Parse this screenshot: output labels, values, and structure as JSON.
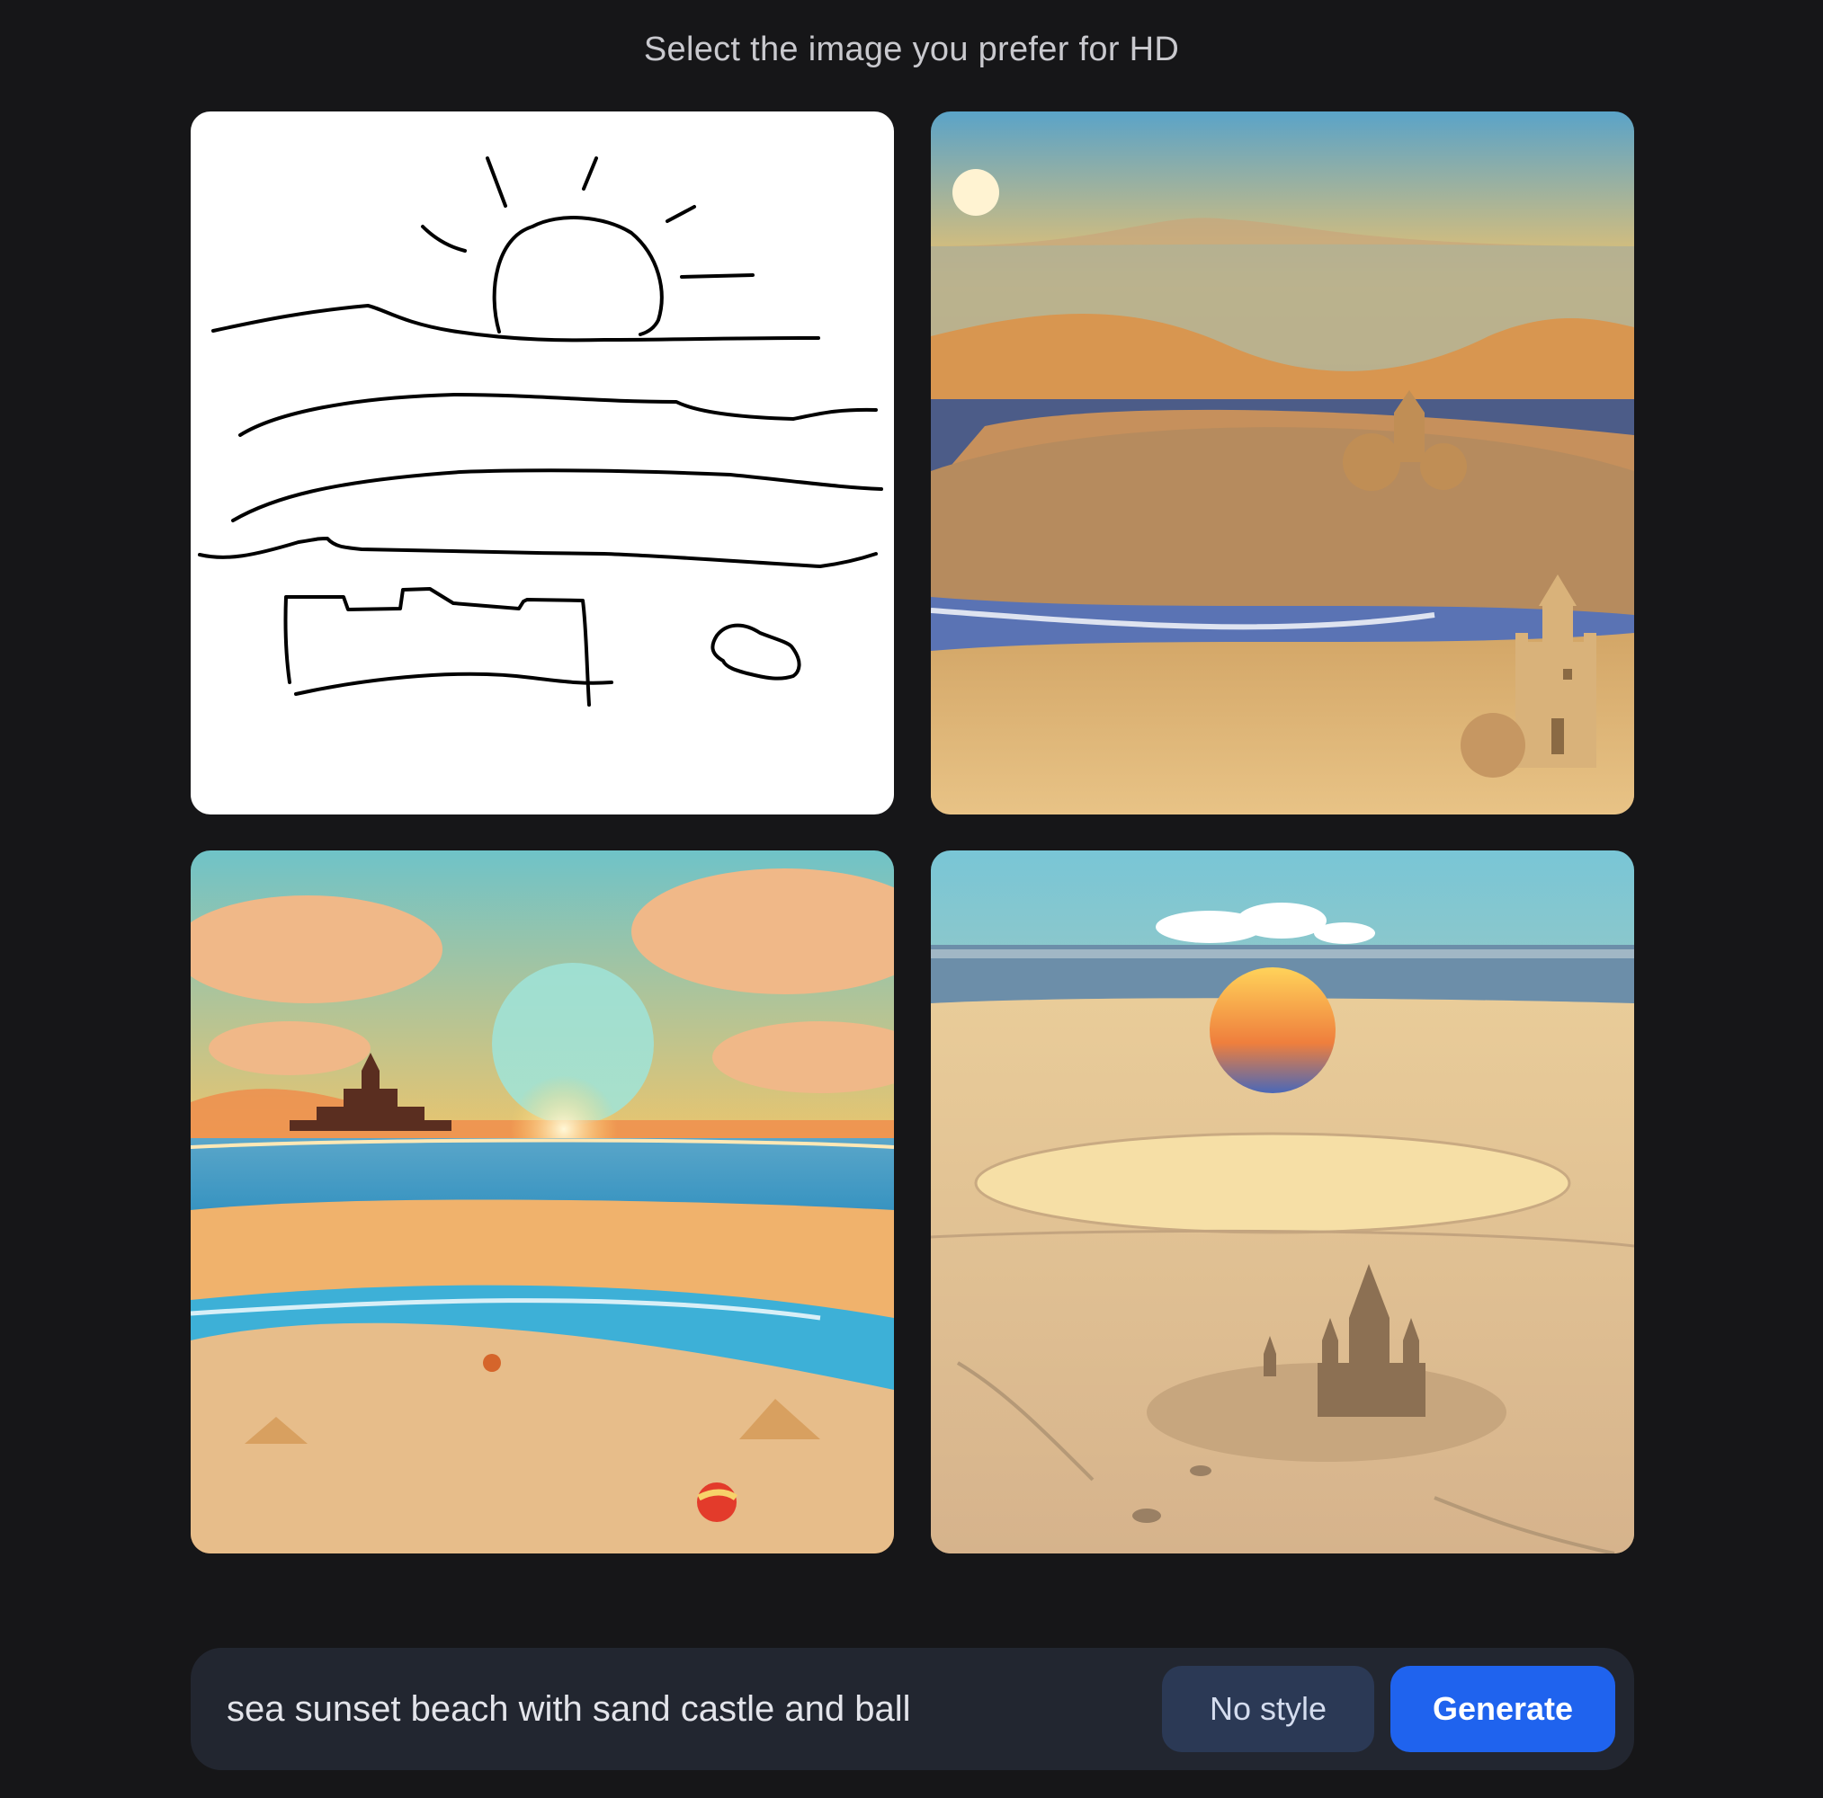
{
  "header": {
    "title": "Select the image you prefer for HD"
  },
  "images": [
    {
      "name": "sketch-canvas",
      "description_icon": "sketch-beach"
    },
    {
      "name": "generated-option-1"
    },
    {
      "name": "generated-option-2"
    },
    {
      "name": "generated-option-3"
    }
  ],
  "prompt": {
    "text": "sea sunset beach with sand castle and ball",
    "style_label": "No style",
    "generate_label": "Generate"
  },
  "colors": {
    "background": "#161618",
    "prompt_bar": "#222630",
    "style_button": "#2b3955",
    "generate_button": "#1f63ee"
  }
}
